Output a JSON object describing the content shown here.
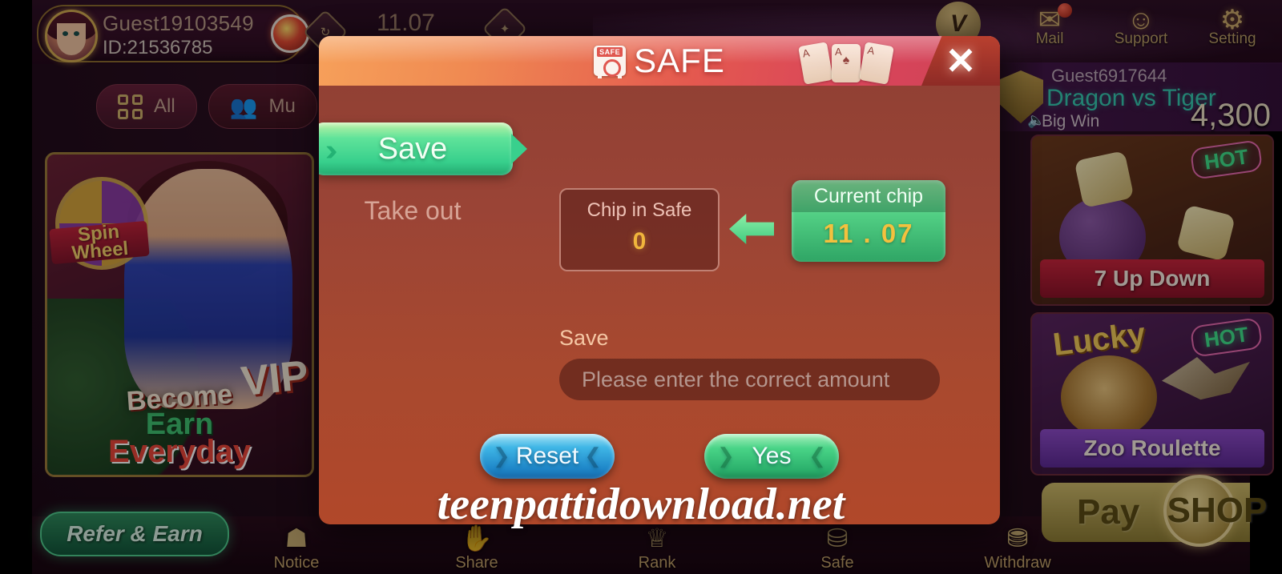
{
  "account": {
    "username": "Guest19103549",
    "id_label": "ID:21536785",
    "balance": "11.07"
  },
  "topbar": {
    "vip_label": "VIP",
    "items": [
      {
        "name": "mail",
        "label": "Mail",
        "glyph": "✉"
      },
      {
        "name": "support",
        "label": "Support",
        "glyph": "☺"
      },
      {
        "name": "setting",
        "label": "Setting",
        "glyph": "⚙"
      }
    ]
  },
  "win_banner": {
    "user": "Guest6917644",
    "game": "Dragon vs Tiger",
    "status": "Big Win",
    "amount": "4,300"
  },
  "categories": [
    {
      "label": "All",
      "icon": "grid-icon",
      "active": true
    },
    {
      "label": "Mu",
      "icon": "people-icon",
      "active": false
    }
  ],
  "hero": {
    "spin_line1": "Spin",
    "spin_line2": "Wheel",
    "line1": "Become",
    "vip": "VIP",
    "line2": "Earn",
    "line3": "Everyday"
  },
  "game_tiles": [
    {
      "title": "7 Up Down",
      "badge": "HOT"
    },
    {
      "title": "Zoo Roulette",
      "badge": "HOT",
      "prefix": "Lucky"
    }
  ],
  "bottom_nav": [
    {
      "label": "Notice",
      "glyph": "☗"
    },
    {
      "label": "Share",
      "glyph": "✋"
    },
    {
      "label": "Rank",
      "glyph": "♕"
    },
    {
      "label": "Safe",
      "glyph": "⛁"
    },
    {
      "label": "Withdraw",
      "glyph": "⛃"
    }
  ],
  "refer_button": "Refer & Earn",
  "pay_button": {
    "label": "Pay",
    "shop_label": "SHOP"
  },
  "modal": {
    "title": "SAFE",
    "icon_tag": "SAFE",
    "close_glyph": "✕",
    "tabs": {
      "save": "Save",
      "take_out": "Take out"
    },
    "chip_in_safe": {
      "label": "Chip in Safe",
      "value": "0"
    },
    "current_chip": {
      "label": "Current chip",
      "value": "11 . 07"
    },
    "save_field": {
      "label": "Save",
      "placeholder": "Please enter the correct amount",
      "value": ""
    },
    "buttons": {
      "reset": "Reset",
      "confirm": "Yes"
    },
    "cards": [
      "A",
      "A",
      "A"
    ]
  },
  "watermark": "teenpattidownload.net",
  "colors": {
    "modal_header_start": "#f6a05a",
    "modal_header_end": "#cf4257",
    "modal_body": "#a8492f",
    "accent_green": "#37cf8c",
    "accent_blue": "#1e86c8",
    "gold": "#f0b53c"
  }
}
